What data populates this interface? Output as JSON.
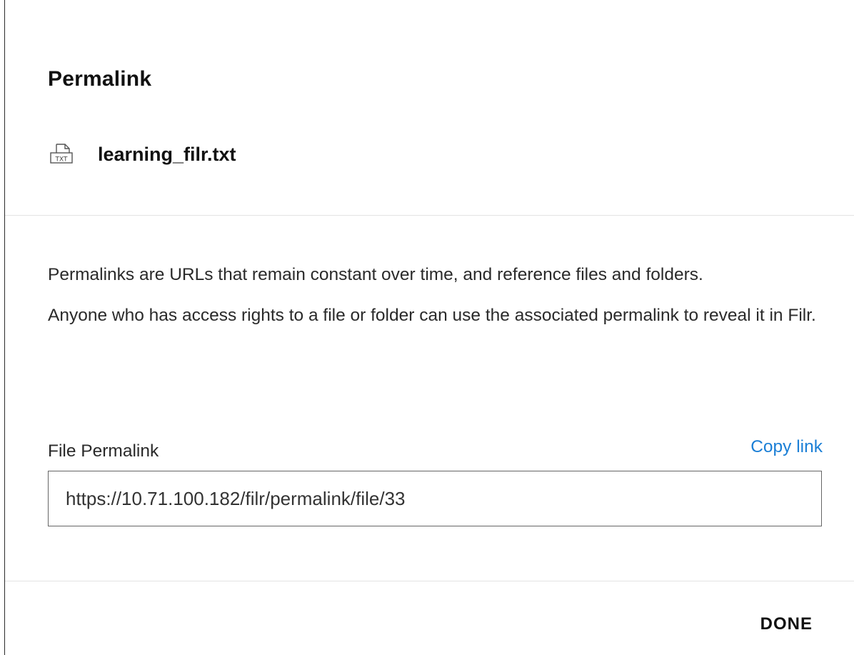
{
  "dialog": {
    "title": "Permalink"
  },
  "file": {
    "icon": "txt-file-icon",
    "icon_text": "TXT",
    "name": "learning_filr.txt"
  },
  "description": {
    "line1": "Permalinks are URLs that remain constant over time, and reference files and folders.",
    "line2": "Anyone who has access rights to a file or folder can use the associated permalink to reveal it in Filr."
  },
  "permalink": {
    "label": "File Permalink",
    "copy_label": "Copy link",
    "value": "https://10.71.100.182/filr/permalink/file/33"
  },
  "footer": {
    "done_label": "DONE"
  },
  "colors": {
    "link": "#1b7fd6",
    "divider": "#e3e3e3",
    "border": "#2b2b2b"
  }
}
